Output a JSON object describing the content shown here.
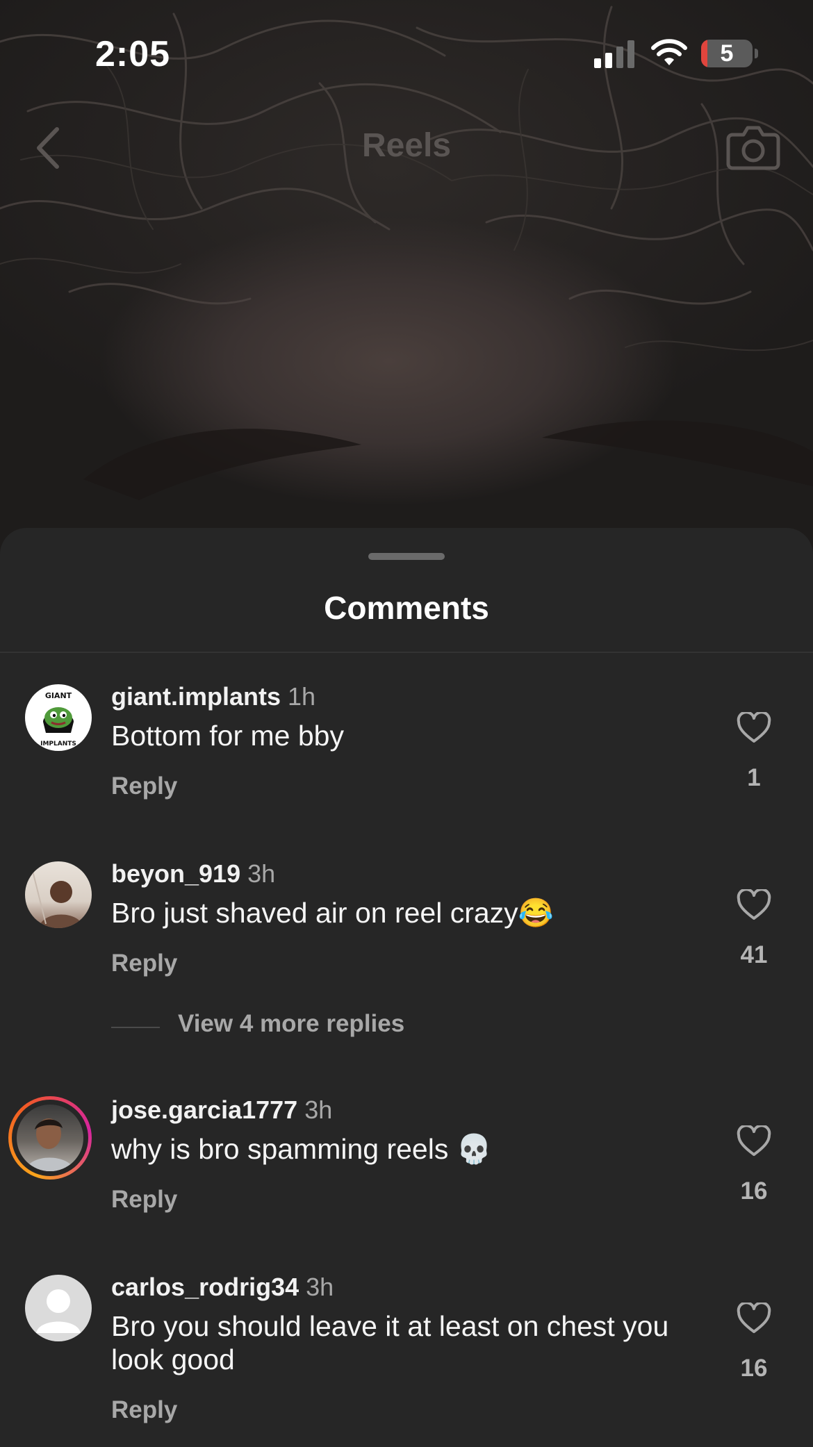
{
  "status_bar": {
    "time": "2:05",
    "battery_level": "5"
  },
  "header": {
    "title": "Reels"
  },
  "sheet": {
    "title": "Comments"
  },
  "comments": [
    {
      "username": "giant.implants",
      "time": "1h",
      "text": "Bottom for me bby",
      "reply_label": "Reply",
      "likes": "1"
    },
    {
      "username": "beyon_919",
      "time": "3h",
      "text": "Bro just shaved air on reel crazy😂",
      "reply_label": "Reply",
      "likes": "41",
      "view_replies": "View 4 more replies"
    },
    {
      "username": "jose.garcia1777",
      "time": "3h",
      "text": "why is bro spamming reels 💀",
      "reply_label": "Reply",
      "likes": "16"
    },
    {
      "username": "carlos_rodrig34",
      "time": "3h",
      "text": "Bro you should leave it at least on chest you look good",
      "reply_label": "Reply",
      "likes": "16"
    }
  ],
  "avatar_logo_text": "GIANT IMPLANTS",
  "colors": {
    "sheet_bg": "#262626",
    "story_ring_start": "#f9a51b",
    "story_ring_end": "#d6249f"
  }
}
